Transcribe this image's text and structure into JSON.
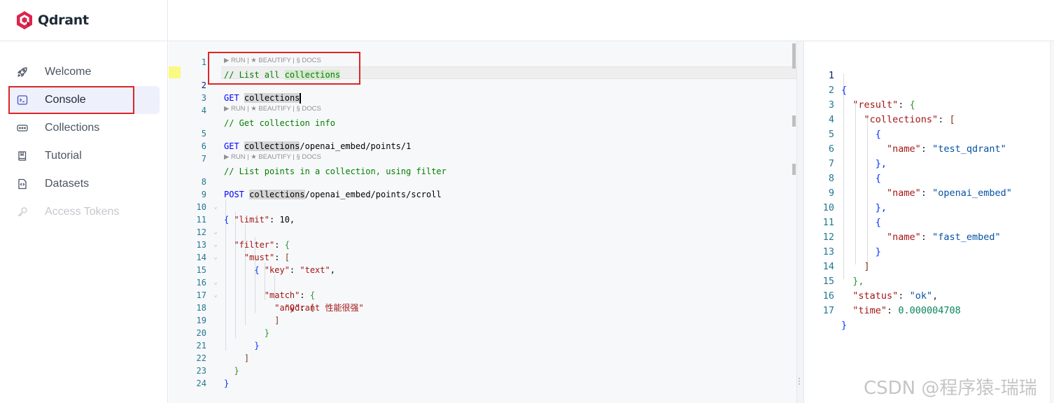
{
  "app": {
    "name": "Qdrant"
  },
  "sidebar": {
    "items": [
      {
        "label": "Welcome",
        "icon": "rocket-icon",
        "state": "normal"
      },
      {
        "label": "Console",
        "icon": "terminal-icon",
        "state": "active"
      },
      {
        "label": "Collections",
        "icon": "collections-icon",
        "state": "normal"
      },
      {
        "label": "Tutorial",
        "icon": "book-icon",
        "state": "normal"
      },
      {
        "label": "Datasets",
        "icon": "dataset-file-icon",
        "state": "normal"
      },
      {
        "label": "Access Tokens",
        "icon": "key-icon",
        "state": "disabled"
      }
    ]
  },
  "editor": {
    "code_lens": "▶ RUN | ★ BEAUTIFY | § DOCS",
    "current_line": 2,
    "lines": [
      {
        "n": "1",
        "text": "// List all collections"
      },
      {
        "n": "2",
        "text": "GET collections"
      },
      {
        "n": "3",
        "text": ""
      },
      {
        "n": "4",
        "text": "// Get collection info"
      },
      {
        "n": "5",
        "text": "GET collections/openai_embed/points/1"
      },
      {
        "n": "6",
        "text": ""
      },
      {
        "n": "7",
        "text": "// List points in a collection, using filter"
      },
      {
        "n": "8",
        "text": "POST collections/openai_embed/points/scroll"
      },
      {
        "n": "9",
        "text": "{"
      },
      {
        "n": "10",
        "text": "  \"limit\": 10,"
      },
      {
        "n": "11",
        "text": "  \"filter\": {"
      },
      {
        "n": "12",
        "text": "    \"must\": ["
      },
      {
        "n": "13",
        "text": "      {"
      },
      {
        "n": "14",
        "text": "        \"key\": \"text\","
      },
      {
        "n": "15",
        "text": "        \"match\": {"
      },
      {
        "n": "16",
        "text": "          \"any\": ["
      },
      {
        "n": "17",
        "text": "            \"Qdrant 性能很强\""
      },
      {
        "n": "18",
        "text": "          ]"
      },
      {
        "n": "19",
        "text": "        }"
      },
      {
        "n": "20",
        "text": "      }"
      },
      {
        "n": "21",
        "text": "    ]"
      },
      {
        "n": "22",
        "text": "  }"
      },
      {
        "n": "23",
        "text": "}"
      },
      {
        "n": "24",
        "text": ""
      }
    ]
  },
  "result": {
    "lines": [
      {
        "n": "1",
        "text": "{"
      },
      {
        "n": "2",
        "text": "  \"result\": {"
      },
      {
        "n": "3",
        "text": "    \"collections\": ["
      },
      {
        "n": "4",
        "text": "      {"
      },
      {
        "n": "5",
        "text": "        \"name\": \"test_qdrant\""
      },
      {
        "n": "6",
        "text": "      },"
      },
      {
        "n": "7",
        "text": "      {"
      },
      {
        "n": "8",
        "text": "        \"name\": \"openai_embed\""
      },
      {
        "n": "9",
        "text": "      },"
      },
      {
        "n": "10",
        "text": "      {"
      },
      {
        "n": "11",
        "text": "        \"name\": \"fast_embed\""
      },
      {
        "n": "12",
        "text": "      }"
      },
      {
        "n": "13",
        "text": "    ]"
      },
      {
        "n": "14",
        "text": "  },"
      },
      {
        "n": "15",
        "text": "  \"status\": \"ok\","
      },
      {
        "n": "16",
        "text": "  \"time\": 0.000004708"
      },
      {
        "n": "17",
        "text": "}"
      }
    ]
  },
  "watermark": "CSDN @程序猿-瑞瑞",
  "colors": {
    "accent": "#dc244c",
    "highlight_box": "#dc2626",
    "active_nav_bg": "#eef0fc",
    "comment": "#008000",
    "keyword": "#0000ff",
    "json_key": "#a31515",
    "json_string": "#0451a5",
    "json_number": "#098658"
  }
}
